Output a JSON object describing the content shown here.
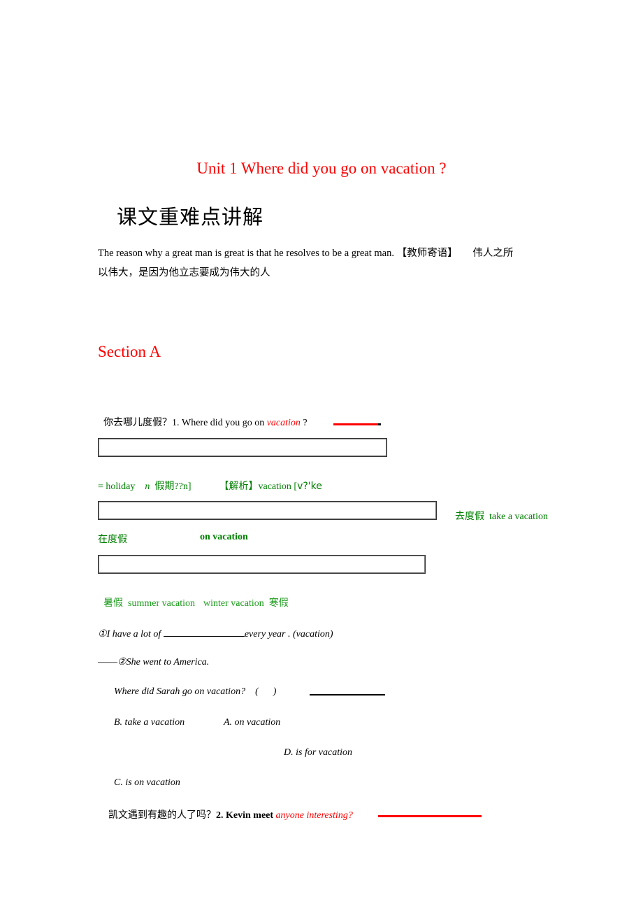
{
  "document": {
    "title": "Unit 1 Where did you go on vacation ?",
    "heading": "课文重难点讲解",
    "motto": {
      "line1_en": "The reason why a great man is great is that he resolves to be a great man.",
      "line1_tag": "【教师寄语】",
      "line1_cn": "伟人之所",
      "line2_cn": "以伟大，是因为他立志要成为伟大的人"
    },
    "section_title": "Section A",
    "question1": {
      "cn": "你去哪儿度假？",
      "prefix": "1. Where did you go on ",
      "keyword": "vacation",
      "suffix": " ?"
    },
    "vocab": {
      "holiday": "= holiday",
      "pos": "n",
      "meaning": "假期??n]",
      "analysis_tag": "【解析】",
      "word": "vacation [",
      "phonetic": "v?'ke",
      "take_cn": "去度假",
      "take_en": "take a vacation",
      "on_cn": "在度假",
      "on_en": "on vacation",
      "summer_cn": "暑假",
      "summer_en": "summer vacation",
      "winter_en": "winter vacation",
      "winter_cn": "寒假"
    },
    "exercises": {
      "ex1_num": "①",
      "ex1_prefix": "I have a lot of ",
      "ex1_suffix": "every year . (vacation)",
      "ex2_dash": "——",
      "ex2_num": "②",
      "ex2_text": "She went to America.",
      "ex3_text": "Where did Sarah go on vacation?    (      )",
      "option_b": "B. take a vacation",
      "option_a": "A. on vacation",
      "option_d": "D. is for vacation",
      "option_c": "C. is on vacation"
    },
    "question2": {
      "cn": "凯文遇到有趣的人了吗？",
      "bold": "2. Kevin meet ",
      "keyword": "anyone interesting?"
    }
  },
  "colors": {
    "accent_red": "#ff0000",
    "note_green": "#008000"
  }
}
